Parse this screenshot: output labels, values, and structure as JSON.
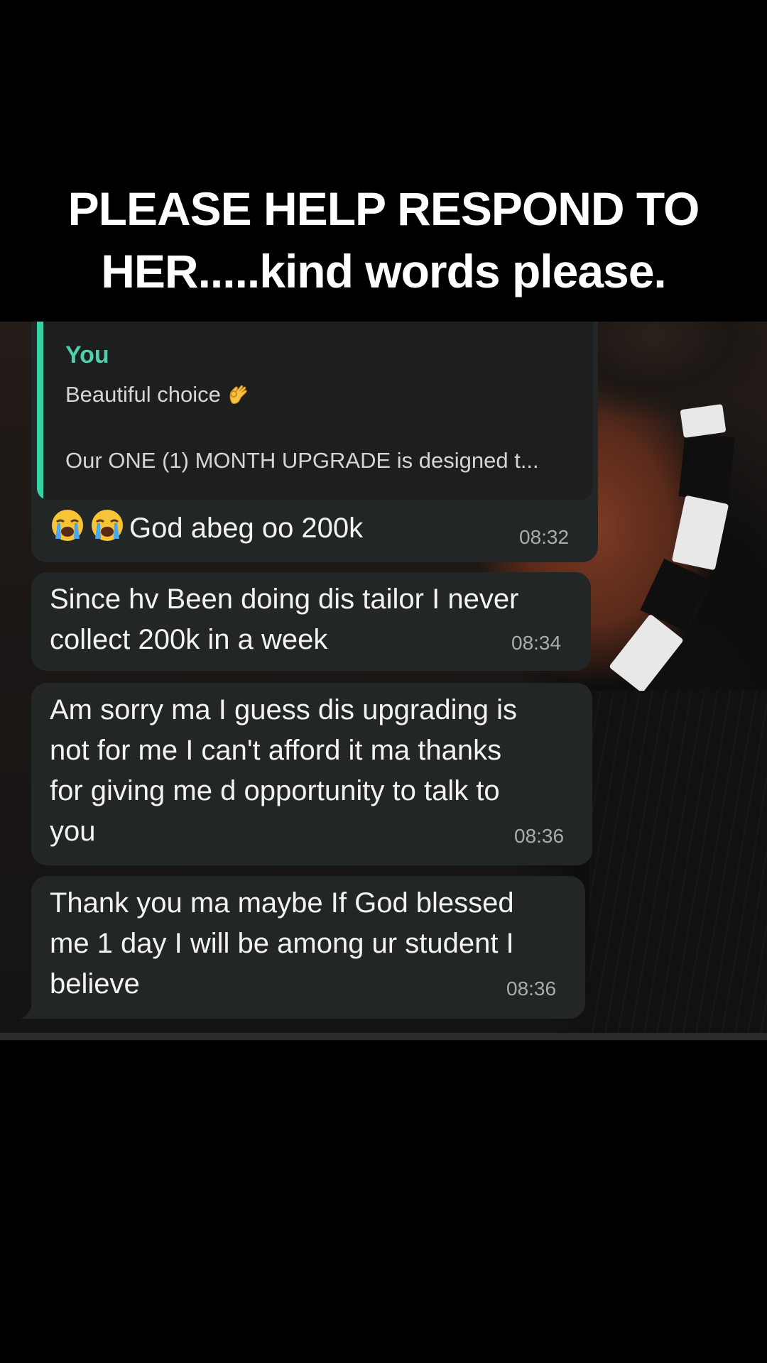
{
  "caption": {
    "line1": "PLEASE HELP RESPOND TO",
    "line2": "HER.....kind words please."
  },
  "messages": [
    {
      "reply": {
        "author": "You",
        "line1": "Beautiful choice",
        "line1_emoji": "ok-hand-emoji",
        "line2": "Our ONE (1) MONTH UPGRADE is designed t..."
      },
      "emoji": [
        "loudly-crying-face-emoji",
        "loudly-crying-face-emoji"
      ],
      "text": "God abeg oo 200k",
      "time": "08:32"
    },
    {
      "lines": [
        "Since hv Been doing dis tailor I never",
        "collect 200k in a week"
      ],
      "time": "08:34"
    },
    {
      "lines": [
        "Am sorry ma I guess dis upgrading is",
        "not for me I can't afford it ma thanks",
        "for giving me d opportunity to talk to",
        "you"
      ],
      "time": "08:36"
    },
    {
      "lines": [
        "Thank you ma maybe If God blessed",
        "me 1 day I will be among ur student I",
        "believe"
      ],
      "time": "08:36"
    }
  ],
  "colors": {
    "bubble": "#232626",
    "quote_accent": "#37d2a4",
    "quote_author": "#4fd0ad",
    "timestamp": "#a9acad"
  }
}
